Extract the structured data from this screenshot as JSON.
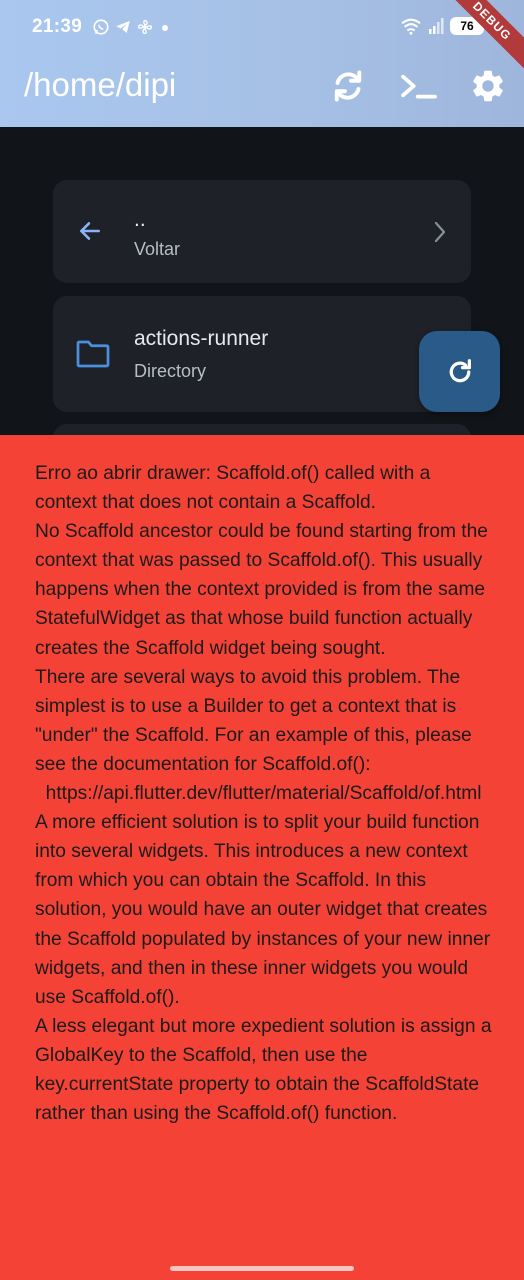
{
  "status_bar": {
    "time": "21:39",
    "left_icons": [
      "whatsapp-icon",
      "telegram-icon",
      "fan-icon",
      "dot-icon"
    ],
    "right_icons": [
      "wifi-icon",
      "signal-icon"
    ],
    "battery": "76",
    "debug_banner": "DEBUG"
  },
  "app_bar": {
    "title": "/home/dipi",
    "actions": [
      "refresh-icon",
      "terminal-icon",
      "settings-icon"
    ]
  },
  "list": {
    "items": [
      {
        "icon": "back-arrow-icon",
        "title": "..",
        "subtitle": "Voltar",
        "trailing": "chevron-right-icon"
      },
      {
        "icon": "folder-icon",
        "title": "actions-runner",
        "subtitle": "Directory"
      }
    ]
  },
  "fab": {
    "icon": "refresh-icon"
  },
  "error": {
    "text": "Erro ao abrir drawer: Scaffold.of() called with a context that does not contain a Scaffold.\nNo Scaffold ancestor could be found starting from the context that was passed to Scaffold.of(). This usually happens when the context provided is from the same StatefulWidget as that whose build function actually creates the Scaffold widget being sought.\nThere are several ways to avoid this problem. The simplest is to use a Builder to get a context that is \"under\" the Scaffold. For an example of this, please see the documentation for Scaffold.of():\n  https://api.flutter.dev/flutter/material/Scaffold/of.html\nA more efficient solution is to split your build function into several widgets. This introduces a new context from which you can obtain the Scaffold. In this solution, you would have an outer widget that creates the Scaffold populated by instances of your new inner widgets, and then in these inner widgets you would use Scaffold.of().\nA less elegant but more expedient solution is assign a GlobalKey to the Scaffold, then use the key.currentState property to obtain the ScaffoldState rather than using the Scaffold.of() function."
  },
  "colors": {
    "app_bar": "#a9c7ef",
    "background": "#111418",
    "card": "#1e2228",
    "accent": "#8ab4f8",
    "fab": "#2a5a88",
    "error": "#f44336"
  }
}
